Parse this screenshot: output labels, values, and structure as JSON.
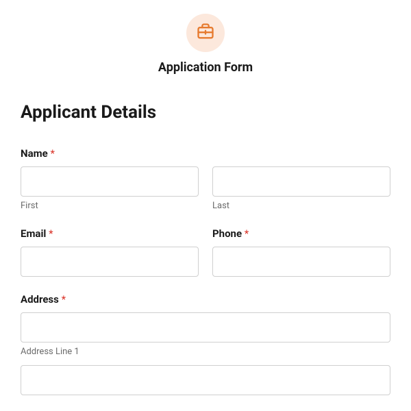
{
  "header": {
    "title": "Application Form",
    "icon": "briefcase-icon"
  },
  "section": {
    "heading": "Applicant Details"
  },
  "fields": {
    "name": {
      "label": "Name",
      "required": "*",
      "first_value": "",
      "first_sublabel": "First",
      "last_value": "",
      "last_sublabel": "Last"
    },
    "email": {
      "label": "Email",
      "required": "*",
      "value": ""
    },
    "phone": {
      "label": "Phone",
      "required": "*",
      "value": ""
    },
    "address": {
      "label": "Address",
      "required": "*",
      "line1_value": "",
      "line1_sublabel": "Address Line 1",
      "line2_value": ""
    }
  }
}
